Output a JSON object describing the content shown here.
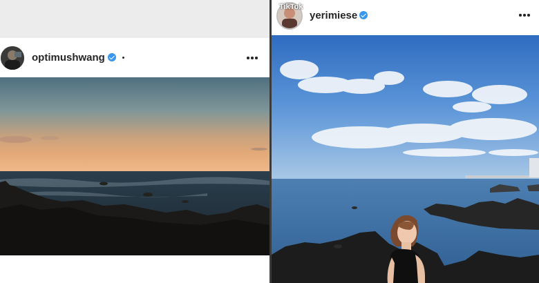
{
  "left_post": {
    "username": "optimushwang",
    "verified": true,
    "more_icon": "more-horizontal-icon",
    "photo_subject": "sunset over rocky sea shore"
  },
  "right_post": {
    "username": "yerimiese",
    "verified": true,
    "watermark": "TikTok",
    "more_icon": "more-horizontal-icon",
    "photo_subject": "woman in black dress on rocky shore under blue sky"
  },
  "colors": {
    "verified_badge": "#3897f0",
    "username_text": "#262626",
    "background": "#ececec"
  }
}
